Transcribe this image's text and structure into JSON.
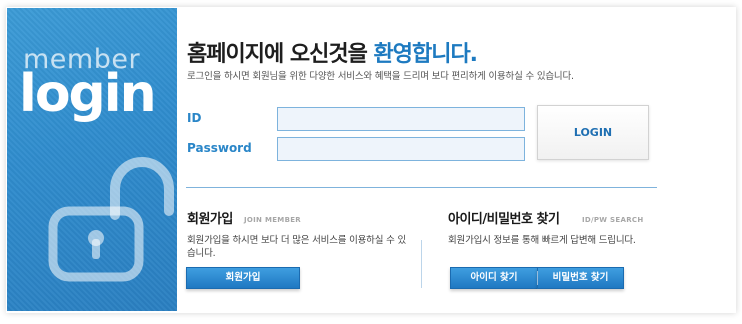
{
  "side": {
    "member_text": "member",
    "login_text": "login",
    "lock_icon": "unlocked-padlock-icon"
  },
  "header": {
    "welcome_prefix": "홈페이지에 오신것을 ",
    "welcome_accent": "환영합니다.",
    "subtitle": "로그인을 하시면 회원님을 위한 다양한 서비스와 혜택을 드리며 보다 편리하게 이용하실 수 있습니다."
  },
  "form": {
    "id_label": "ID",
    "password_label": "Password",
    "id_value": "",
    "password_value": "",
    "login_button": "LOGIN"
  },
  "join": {
    "title": "회원가입",
    "subtitle": "JOIN MEMBER",
    "description": "회원가입을 하시면 보다 더 많은 서비스를 이용하실 수 있습니다.",
    "button": "회원가입"
  },
  "find": {
    "title": "아이디/비밀번호 찾기",
    "subtitle": "ID/PW SEARCH",
    "description": "회원가입시 정보를 통해 빠르게 답변해 드립니다.",
    "find_id_button": "아이디 찾기",
    "find_pw_button": "비밀번호 찾기"
  },
  "colors": {
    "accent": "#1d7ac0",
    "panel": "#2f8ccd",
    "button": "#2a86d0"
  }
}
